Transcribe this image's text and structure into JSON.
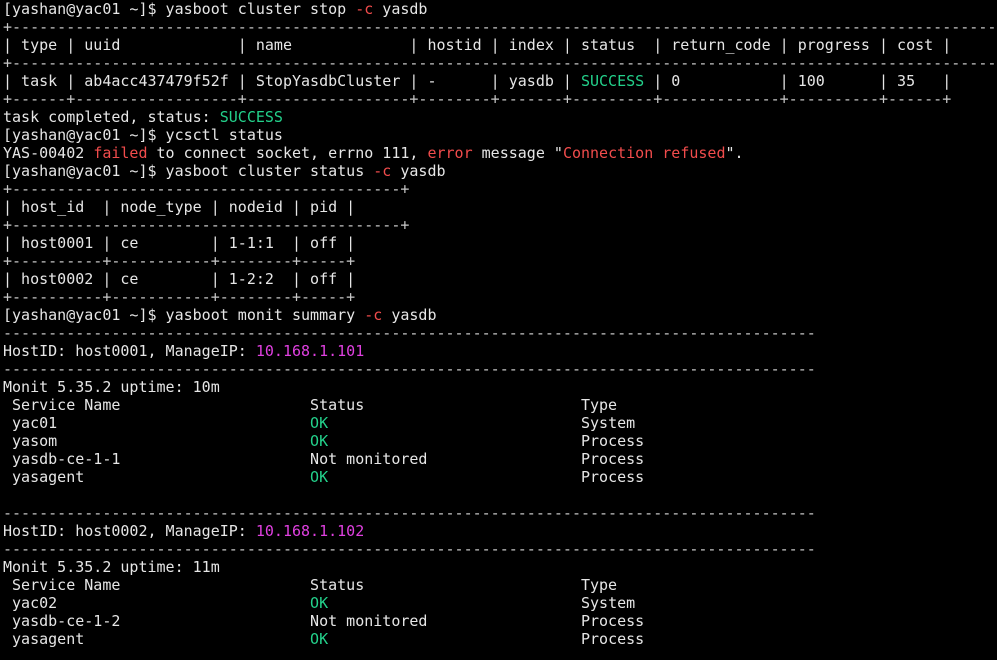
{
  "window": {
    "title": "",
    "colors": {
      "background": "#000000",
      "text": "#e6e6e6",
      "success": "#23d18b",
      "error": "#f14c4c",
      "ip": "#e040e0"
    }
  },
  "terminal": {
    "lines": [
      [
        {
          "t": "[yashan@yac01 ~]$ yasboot cluster stop ",
          "c": "default"
        },
        {
          "t": "-c",
          "c": "red"
        },
        {
          "t": " yasdb",
          "c": "default"
        }
      ],
      [
        {
          "t": "+---------------------------------------------------------------------------------------------------------------+",
          "c": "dim"
        }
      ],
      [
        {
          "t": "| type | uuid             | name             | hostid | index | status  | return_code | progress | cost |",
          "c": "default"
        }
      ],
      [
        {
          "t": "+---------------------------------------------------------------------------------------------------------------+",
          "c": "dim"
        }
      ],
      [
        {
          "t": "| task | ab4acc437479f52f | StopYasdbCluster | -      | yasdb | ",
          "c": "default"
        },
        {
          "t": "SUCCESS",
          "c": "green"
        },
        {
          "t": " | 0           | 100      | 35   |",
          "c": "default"
        }
      ],
      [
        {
          "t": "+------+------------------+------------------+--------+-------+---------+-------------+----------+------+",
          "c": "dim"
        }
      ],
      [
        {
          "t": "task completed, status: ",
          "c": "default"
        },
        {
          "t": "SUCCESS",
          "c": "green"
        }
      ],
      [
        {
          "t": "[yashan@yac01 ~]$ ycsctl status",
          "c": "default"
        }
      ],
      [
        {
          "t": "YAS-00402 ",
          "c": "default"
        },
        {
          "t": "failed",
          "c": "red"
        },
        {
          "t": " to connect socket, errno 111, ",
          "c": "default"
        },
        {
          "t": "error",
          "c": "red"
        },
        {
          "t": " message \"",
          "c": "default"
        },
        {
          "t": "Connection refused",
          "c": "red"
        },
        {
          "t": "\".",
          "c": "default"
        }
      ],
      [
        {
          "t": "[yashan@yac01 ~]$ yasboot cluster status ",
          "c": "default"
        },
        {
          "t": "-c",
          "c": "red"
        },
        {
          "t": " yasdb",
          "c": "default"
        }
      ],
      [
        {
          "t": "+-------------------------------------------+",
          "c": "dim"
        }
      ],
      [
        {
          "t": "| host_id  | node_type | nodeid | pid |",
          "c": "default"
        }
      ],
      [
        {
          "t": "+-------------------------------------------+",
          "c": "dim"
        }
      ],
      [
        {
          "t": "| host0001 | ce        | 1-1:1  | off |",
          "c": "default"
        }
      ],
      [
        {
          "t": "+----------+-----------+--------+-----+",
          "c": "dim"
        }
      ],
      [
        {
          "t": "| host0002 | ce        | 1-2:2  | off |",
          "c": "default"
        }
      ],
      [
        {
          "t": "+----------+-----------+--------+-----+",
          "c": "dim"
        }
      ],
      [
        {
          "t": "[yashan@yac01 ~]$ yasboot monit summary ",
          "c": "default"
        },
        {
          "t": "-c",
          "c": "red"
        },
        {
          "t": " yasdb",
          "c": "default"
        }
      ],
      [
        {
          "t": "------------------------------------------------------------------------------------------",
          "c": "dim"
        }
      ],
      [
        {
          "t": "HostID: host0001, ManageIP: ",
          "c": "default"
        },
        {
          "t": "10.168.1.101",
          "c": "magenta"
        }
      ],
      [
        {
          "t": "------------------------------------------------------------------------------------------",
          "c": "dim"
        }
      ],
      [
        {
          "t": "Monit 5.35.2 uptime: 10m",
          "c": "default"
        }
      ],
      [
        {
          "t": " Service Name                     Status                        Type",
          "c": "default"
        }
      ],
      [
        {
          "t": " yac01                            ",
          "c": "default"
        },
        {
          "t": "OK",
          "c": "green"
        },
        {
          "t": "                            System",
          "c": "default"
        }
      ],
      [
        {
          "t": " yasom                            ",
          "c": "default"
        },
        {
          "t": "OK",
          "c": "green"
        },
        {
          "t": "                            Process",
          "c": "default"
        }
      ],
      [
        {
          "t": " yasdb-ce-1-1                     Not monitored                 Process",
          "c": "default"
        }
      ],
      [
        {
          "t": " yasagent                         ",
          "c": "default"
        },
        {
          "t": "OK",
          "c": "green"
        },
        {
          "t": "                            Process",
          "c": "default"
        }
      ],
      [
        {
          "t": "",
          "c": "default"
        }
      ],
      [
        {
          "t": "------------------------------------------------------------------------------------------",
          "c": "dim"
        }
      ],
      [
        {
          "t": "HostID: host0002, ManageIP: ",
          "c": "default"
        },
        {
          "t": "10.168.1.102",
          "c": "magenta"
        }
      ],
      [
        {
          "t": "------------------------------------------------------------------------------------------",
          "c": "dim"
        }
      ],
      [
        {
          "t": "Monit 5.35.2 uptime: 11m",
          "c": "default"
        }
      ],
      [
        {
          "t": " Service Name                     Status                        Type",
          "c": "default"
        }
      ],
      [
        {
          "t": " yac02                            ",
          "c": "default"
        },
        {
          "t": "OK",
          "c": "green"
        },
        {
          "t": "                            System",
          "c": "default"
        }
      ],
      [
        {
          "t": " yasdb-ce-1-2                     Not monitored                 Process",
          "c": "default"
        }
      ],
      [
        {
          "t": " yasagent                         ",
          "c": "default"
        },
        {
          "t": "OK",
          "c": "green"
        },
        {
          "t": "                            Process",
          "c": "default"
        }
      ]
    ]
  }
}
